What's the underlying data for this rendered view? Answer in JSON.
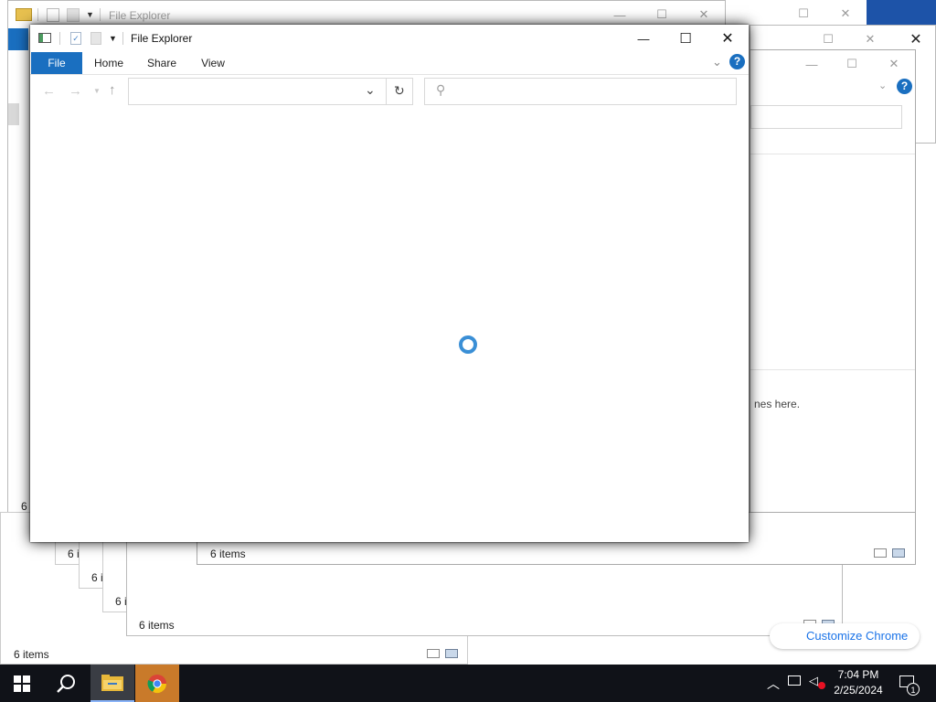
{
  "background_windows": [
    {
      "title": "File Explorer",
      "status": "6",
      "status_full": "6 items"
    },
    {
      "status": "6 items"
    },
    {
      "status": "6 items"
    },
    {
      "status": "6 items"
    },
    {
      "status": "6 i"
    },
    {
      "status": "6 i"
    },
    {
      "status": "6 items"
    }
  ],
  "right_window": {
    "hint_text": "nes here."
  },
  "main_window": {
    "title": "File Explorer",
    "tabs": [
      "File",
      "Home",
      "Share",
      "View"
    ],
    "address_value": "",
    "search_placeholder": "",
    "state": "loading"
  },
  "chrome_hint": {
    "label": "Customize Chrome"
  },
  "taskbar": {
    "time": "7:04 PM",
    "date": "2/25/2024",
    "notification_count": "1",
    "pinned": [
      "start-button",
      "search-button",
      "file-explorer",
      "google-chrome"
    ]
  },
  "colors": {
    "accent": "#1a6fc0",
    "taskbar": "#101218",
    "spinner": "#3a8fd6"
  }
}
